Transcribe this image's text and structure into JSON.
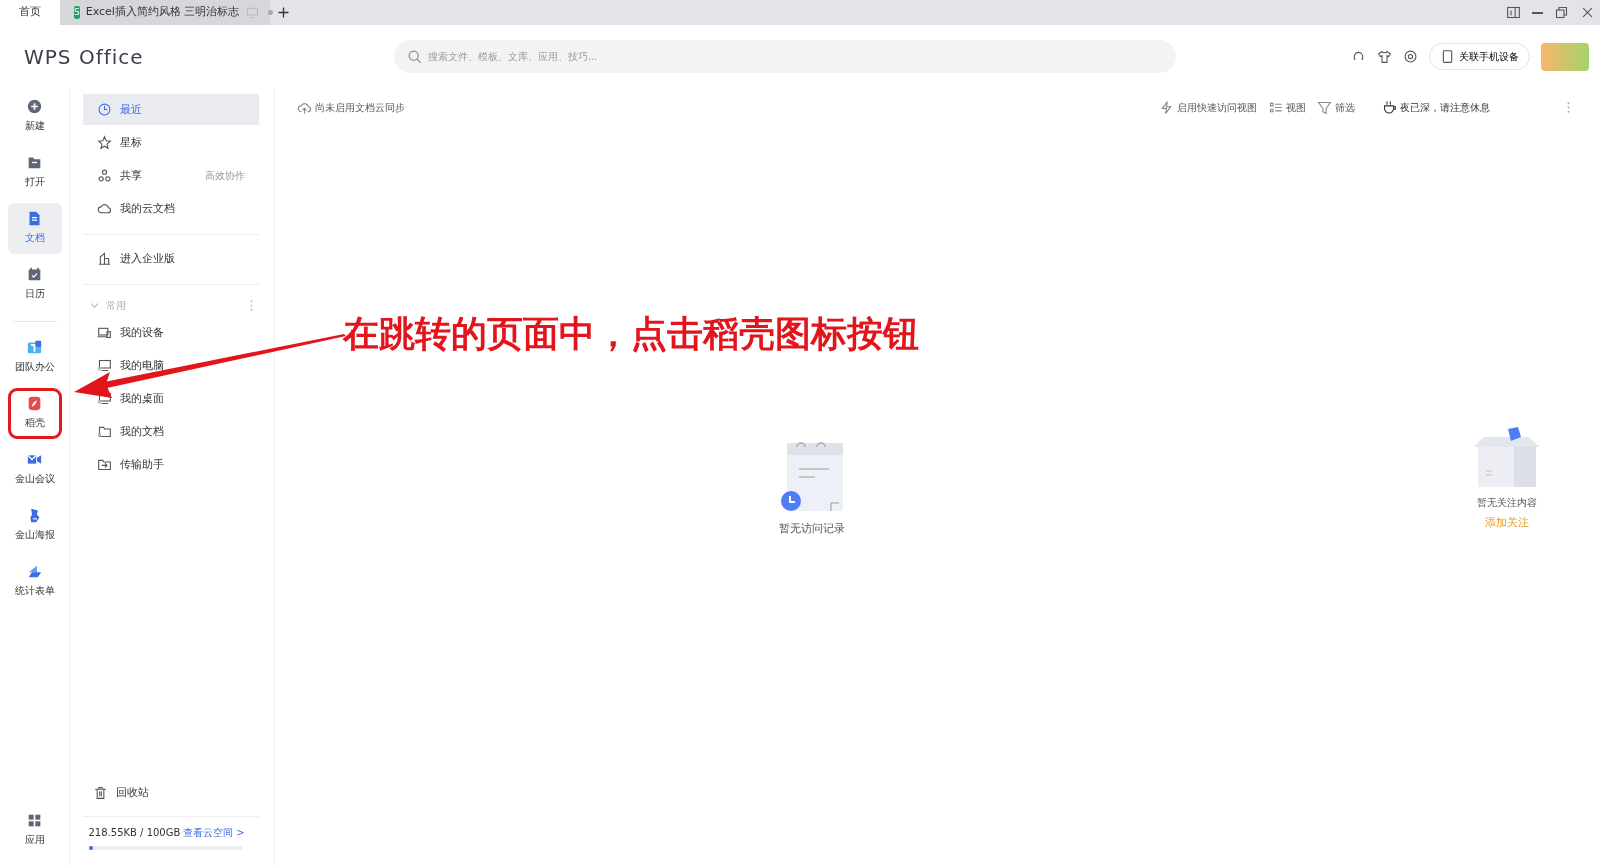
{
  "tabs": [
    {
      "label": "首页",
      "selected": true,
      "kind": "home"
    },
    {
      "label": "Excel插入简约风格 三明治标志",
      "selected": false,
      "kind": "sheet",
      "badge": "S"
    }
  ],
  "app": {
    "logo": "WPS Office"
  },
  "search": {
    "placeholder": "搜索文件、模板、文库、应用、技巧..."
  },
  "header": {
    "device_button": "关联手机设备"
  },
  "rail": {
    "groups": [
      [
        {
          "label": "新建",
          "selected": false,
          "highlighted": false
        },
        {
          "label": "打开",
          "selected": false,
          "highlighted": false
        },
        {
          "label": "文档",
          "selected": true,
          "highlighted": false
        },
        {
          "label": "日历",
          "selected": false,
          "highlighted": false
        }
      ],
      [
        {
          "label": "团队办公",
          "selected": false,
          "highlighted": false
        },
        {
          "label": "稻壳",
          "selected": false,
          "highlighted": true
        },
        {
          "label": "金山会议",
          "selected": false,
          "highlighted": false
        },
        {
          "label": "金山海报",
          "selected": false,
          "highlighted": false
        },
        {
          "label": "统计表单",
          "selected": false,
          "highlighted": false
        }
      ]
    ],
    "bottom": {
      "label": "应用"
    }
  },
  "nav": {
    "groups": [
      [
        {
          "label": "最近",
          "selected": true
        },
        {
          "label": "星标",
          "selected": false
        },
        {
          "label": "共享",
          "selected": false,
          "hint": "高效协作"
        },
        {
          "label": "我的云文档",
          "selected": false
        }
      ],
      [
        {
          "label": "进入企业版",
          "selected": false
        }
      ]
    ],
    "section": {
      "label": "常用",
      "expanded": true,
      "children": [
        {
          "label": "我的设备"
        },
        {
          "label": "我的电脑"
        },
        {
          "label": "我的桌面"
        },
        {
          "label": "我的文档"
        },
        {
          "label": "传输助手"
        }
      ]
    },
    "trash": "回收站",
    "storage": {
      "text": "218.55KB / 100GB",
      "link": "查看云空间",
      "chevron": ">",
      "level": 0.02
    }
  },
  "toolbar": {
    "sync": "尚未启用文档云同步",
    "actions": [
      "启用快速访问视图",
      "视图",
      "筛选"
    ],
    "notice": "夜已深，请注意休息"
  },
  "empty_recent": "暂无访问记录",
  "empty_follow": {
    "text": "暂无关注内容",
    "link": "添加关注"
  },
  "annotation": {
    "text": "在跳转的页面中，点击稻壳图标按钮"
  }
}
